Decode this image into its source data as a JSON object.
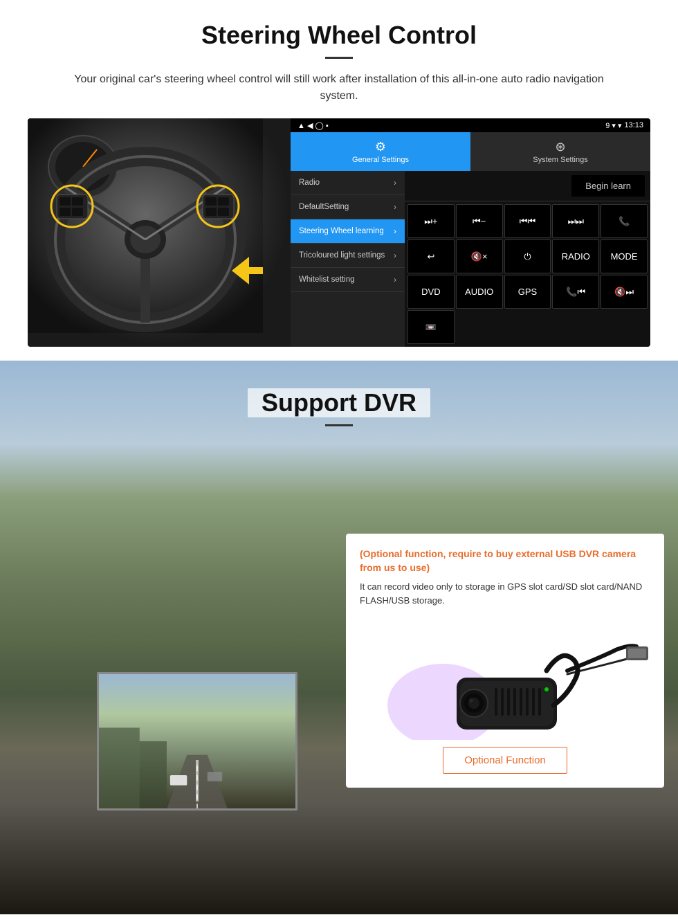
{
  "steering_section": {
    "title": "Steering Wheel Control",
    "description": "Your original car's steering wheel control will still work after installation of this all-in-one auto radio navigation system.",
    "statusbar": {
      "time": "13:13",
      "signal_icon": "▾",
      "wifi_icon": "▾"
    },
    "tabs": [
      {
        "label": "General Settings",
        "icon": "⚙",
        "active": true
      },
      {
        "label": "System Settings",
        "icon": "🔒",
        "active": false
      }
    ],
    "menu_items": [
      {
        "label": "Radio",
        "active": false
      },
      {
        "label": "DefaultSetting",
        "active": false
      },
      {
        "label": "Steering Wheel learning",
        "active": true
      },
      {
        "label": "Tricoloured light settings",
        "active": false
      },
      {
        "label": "Whitelist setting",
        "active": false
      }
    ],
    "begin_learn_label": "Begin learn",
    "control_buttons": [
      "⏭+",
      "⏮−",
      "⏮⏮",
      "⏭⏭",
      "📞",
      "↩",
      "🔇×",
      "⏻",
      "RADIO",
      "MODE",
      "DVD",
      "AUDIO",
      "GPS",
      "📞⏮",
      "🔇⏭"
    ],
    "extra_button": "📼"
  },
  "dvr_section": {
    "title": "Support DVR",
    "card": {
      "optional_text": "(Optional function, require to buy external USB DVR camera from us to use)",
      "description": "It can record video only to storage in GPS slot card/SD slot card/NAND FLASH/USB storage.",
      "button_label": "Optional Function"
    }
  }
}
